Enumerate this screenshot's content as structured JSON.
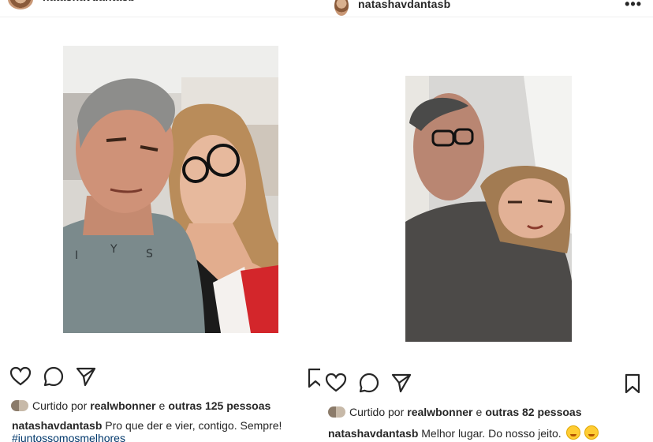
{
  "left_post": {
    "username": "natashavdantasb",
    "liked": {
      "prefix": "Curtido por",
      "user": "realwbonner",
      "conj": "e",
      "others": "outras 125 pessoas"
    },
    "caption": {
      "username": "natashavdantasb",
      "text": "Pro que der e vier, contigo. Sempre!"
    },
    "hashtag": "#juntossomosmelhores",
    "icons": [
      "heart-icon",
      "comment-icon",
      "share-icon",
      "bookmark-icon"
    ]
  },
  "right_post": {
    "username": "natashavdantasb",
    "more": "•••",
    "liked": {
      "prefix": "Curtido por",
      "user": "realwbonner",
      "conj": "e",
      "others": "outras 82 pessoas"
    },
    "caption": {
      "username": "natashavdantasb",
      "text": "Melhor lugar. Do nosso jeito."
    },
    "icons": [
      "heart-icon",
      "comment-icon",
      "share-icon",
      "bookmark-icon"
    ]
  },
  "colors": {
    "text": "#262626",
    "hashtag": "#00376b",
    "divider": "#efefef"
  }
}
